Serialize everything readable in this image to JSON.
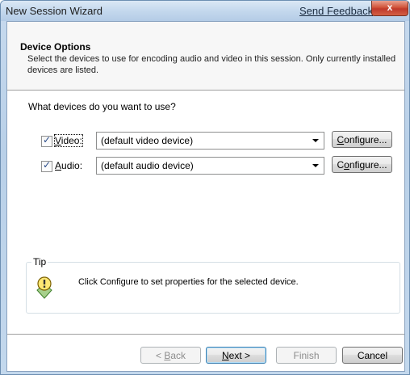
{
  "window": {
    "title": "New Session Wizard",
    "feedback_link": "Send Feedback",
    "close_glyph": "x"
  },
  "header": {
    "title": "Device Options",
    "subtitle": "Select the devices to use for encoding audio and video in this session. Only currently installed devices are listed."
  },
  "main": {
    "question": "What devices do you want to use?",
    "devices": [
      {
        "label_accel": "V",
        "label_rest": "ideo:",
        "checked": true,
        "selected_device": "(default video device)",
        "configure_accel": "C",
        "configure_rest": "onfigure..."
      },
      {
        "label_accel": "A",
        "label_rest": "udio:",
        "checked": true,
        "selected_device": "(default audio device)",
        "configure_pre": "C",
        "configure_accel": "o",
        "configure_rest": "nfigure..."
      }
    ],
    "tip": {
      "legend": "Tip",
      "text": "Click Configure to set properties for the selected device.",
      "icon": "lightbulb-tip-icon"
    }
  },
  "footer": {
    "back_pre": "< ",
    "back_accel": "B",
    "back_rest": "ack",
    "next_accel": "N",
    "next_rest": "ext >",
    "finish_label": "Finish",
    "cancel_label": "Cancel"
  },
  "colors": {
    "frame": "#c3d8ed",
    "close_button": "#c0392b",
    "default_button_border": "#3c7fb1"
  }
}
